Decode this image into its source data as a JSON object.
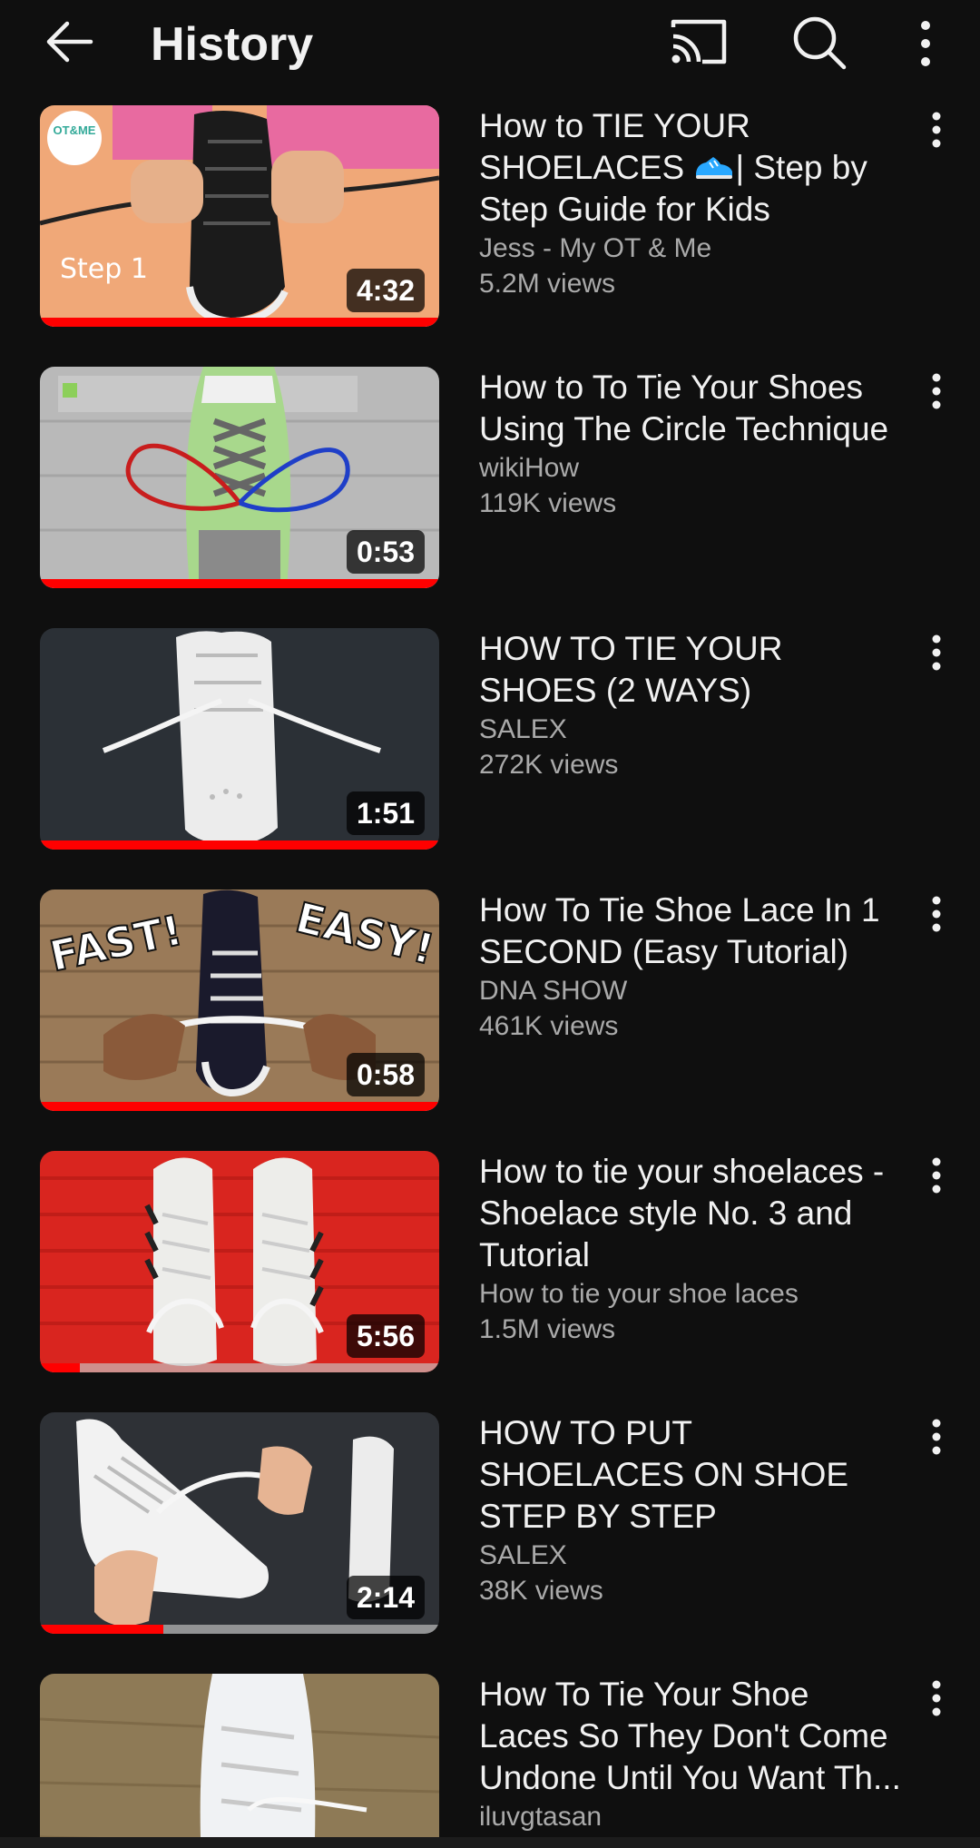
{
  "header": {
    "title": "History",
    "icons": [
      "back-arrow-icon",
      "cast-icon",
      "search-icon",
      "more-vert-icon"
    ]
  },
  "colors": {
    "background": "#0f0f0f",
    "progress": "#ff0000",
    "secondary_text": "#aaaaaa"
  },
  "videos": [
    {
      "title_before": "How to TIE YOUR SHOELACES ",
      "title_after": "| Step by Step Guide for Kids",
      "channel": "Jess - My OT & Me",
      "views": "5.2M views",
      "duration": "4:32",
      "watched_fraction": 1.0,
      "thumbnail_text": [
        "OT&ME",
        "Step 1"
      ]
    },
    {
      "title": "How to To Tie Your Shoes Using The Circle Technique",
      "channel": "wikiHow",
      "views": "119K views",
      "duration": "0:53",
      "watched_fraction": 1.0
    },
    {
      "title": "HOW TO TIE YOUR SHOES (2 WAYS)",
      "channel": "SALEX",
      "views": "272K views",
      "duration": "1:51",
      "watched_fraction": 1.0
    },
    {
      "title": "How To Tie Shoe Lace In 1 SECOND (Easy Tutorial)",
      "channel": "DNA SHOW",
      "views": "461K views",
      "duration": "0:58",
      "watched_fraction": 1.0,
      "thumbnail_text": [
        "FAST!",
        "EASY!"
      ]
    },
    {
      "title": "How to tie your shoelaces - Shoelace style No. 3 and Tutorial",
      "channel": "How to tie your shoe laces",
      "views": "1.5M views",
      "duration": "5:56",
      "watched_fraction": 0.1
    },
    {
      "title": "HOW TO PUT SHOELACES ON SHOE STEP BY STEP",
      "channel": "SALEX",
      "views": "38K views",
      "duration": "2:14",
      "watched_fraction": 0.31
    },
    {
      "title": "How To Tie Your Shoe Laces So They Don't Come Undone Until You Want Th...",
      "channel": "iluvgtasan",
      "views": ""
    }
  ]
}
